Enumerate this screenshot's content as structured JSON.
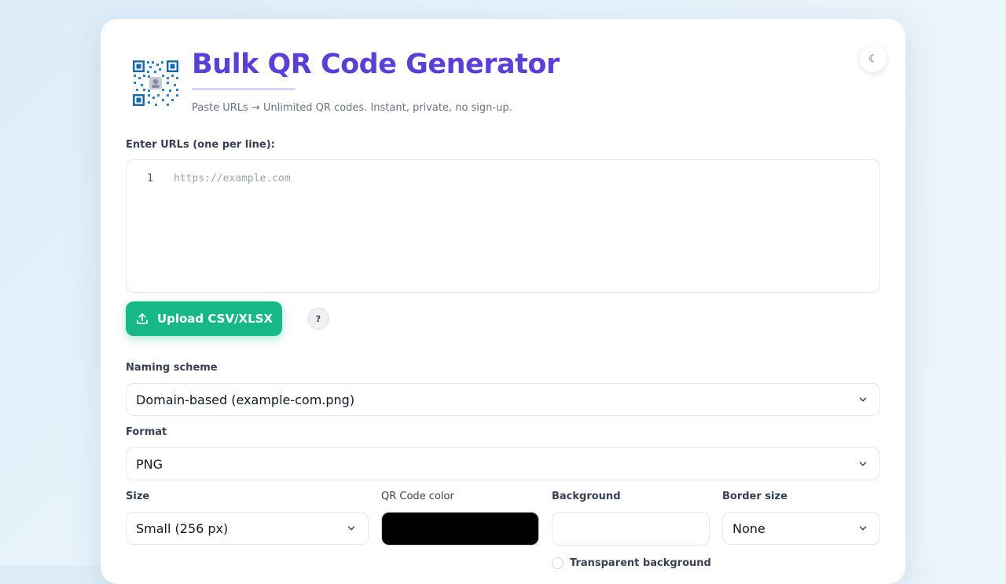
{
  "header": {
    "title": "Bulk QR Code Generator",
    "subtitle": "Paste URLs → Unlimited QR codes. Instant, private, no sign-up.",
    "theme_toggle_glyph": "☾"
  },
  "urls": {
    "label": "Enter URLs (one per line):",
    "line_number": "1",
    "placeholder": "https://example.com"
  },
  "actions": {
    "upload_label": "Upload CSV/XLSX",
    "help_label": "?"
  },
  "naming": {
    "label": "Naming scheme",
    "value": "Domain-based (example-com.png)"
  },
  "format": {
    "label": "Format",
    "value": "PNG"
  },
  "size": {
    "label": "Size",
    "value": "Small (256 px)"
  },
  "qr_color": {
    "label": "QR Code color",
    "value": "#000000"
  },
  "background": {
    "label": "Background",
    "value": "#ffffff",
    "transparent_label": "Transparent background"
  },
  "border": {
    "label": "Border size",
    "value": "None"
  },
  "colors": {
    "accent": "#5b3fd6",
    "upload": "#16b886"
  }
}
